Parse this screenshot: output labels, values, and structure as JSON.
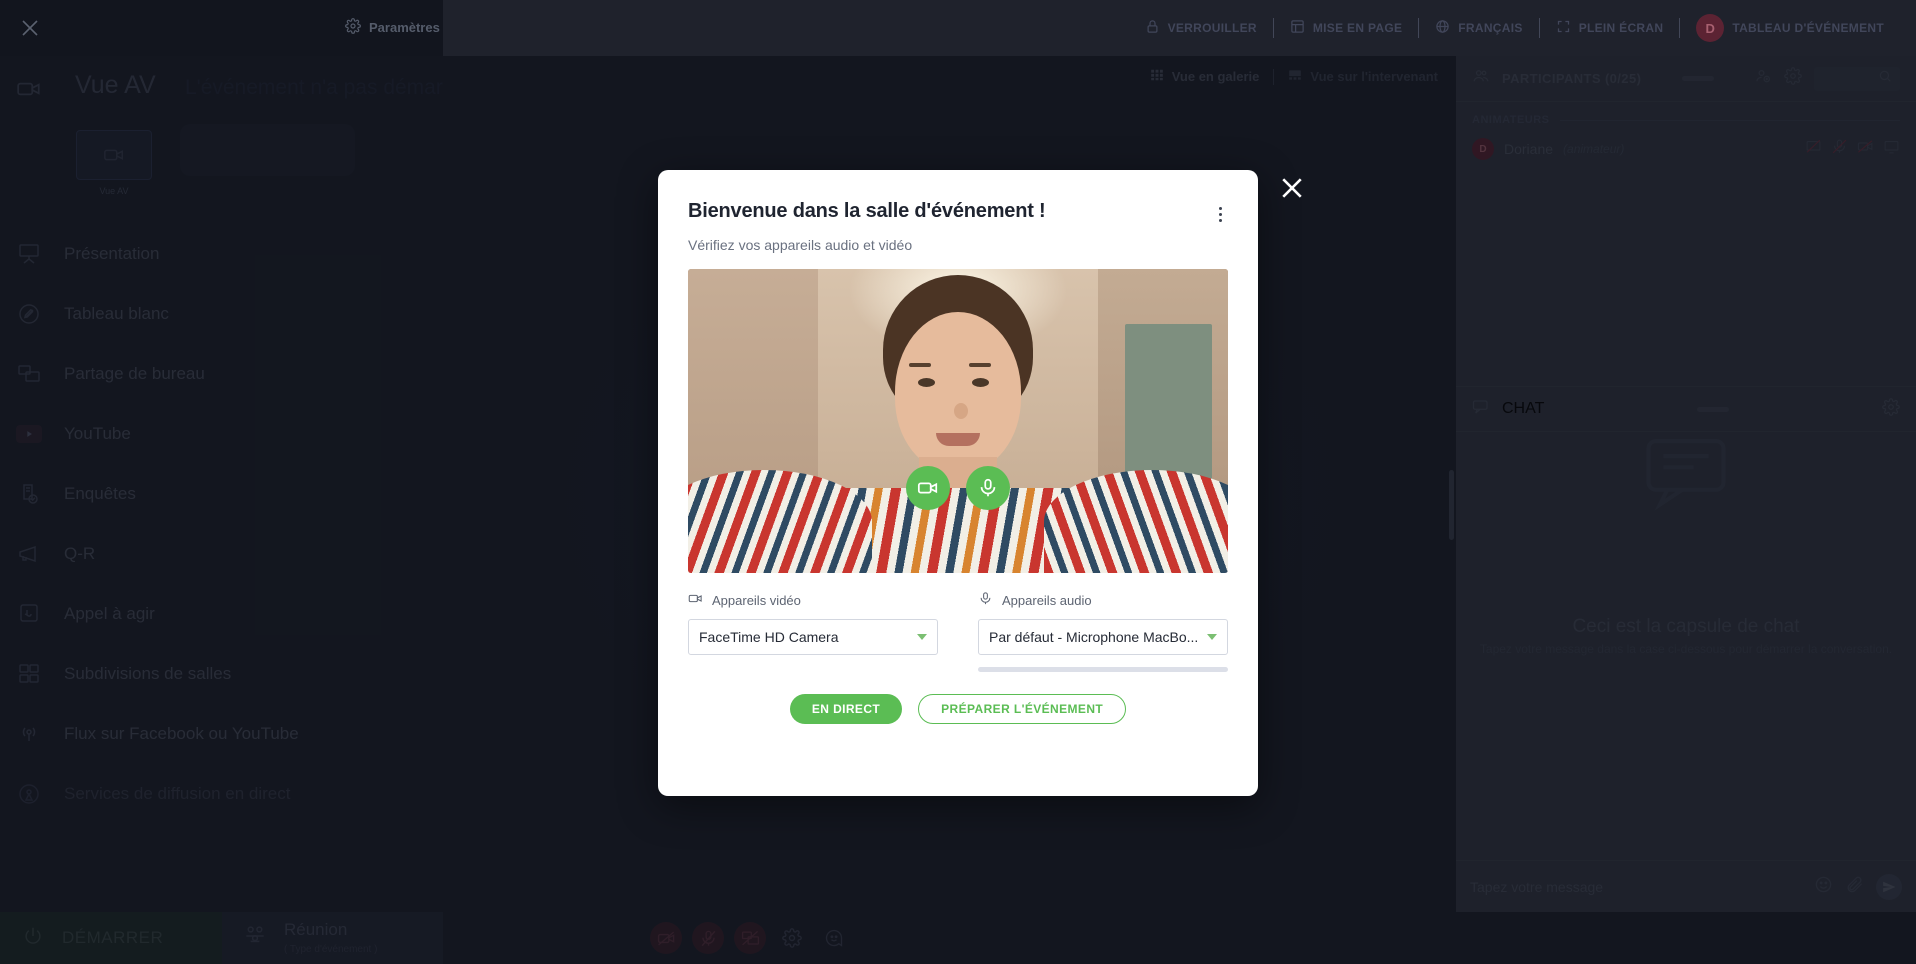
{
  "topbar": {
    "close_icon": "close-icon",
    "settings_label": "Paramètres",
    "items": [
      {
        "label": "VERROUILLER",
        "icon": "lock-icon"
      },
      {
        "label": "MISE EN PAGE",
        "icon": "layout-icon"
      },
      {
        "label": "FRANÇAIS",
        "icon": "globe-icon"
      },
      {
        "label": "PLEIN ÉCRAN",
        "icon": "fullscreen-icon"
      },
      {
        "label": "TABLEAU D'ÉVÉNEMENT",
        "icon": "dashboard-icon",
        "avatar": "D"
      }
    ]
  },
  "sidebar": {
    "header_title": "Vue AV",
    "header_ghost": "L'événement n'a pas démarré",
    "thumb_label": "Vue AV",
    "items": [
      {
        "label": "Présentation",
        "icon": "presentation-icon"
      },
      {
        "label": "Tableau blanc",
        "icon": "pencil-circle-icon"
      },
      {
        "label": "Partage de bureau",
        "icon": "screen-share-icon"
      },
      {
        "label": "YouTube",
        "icon": "youtube-icon"
      },
      {
        "label": "Enquêtes",
        "icon": "survey-icon"
      },
      {
        "label": "Q-R",
        "icon": "megaphone-icon"
      },
      {
        "label": "Appel à agir",
        "icon": "call-to-action-icon"
      },
      {
        "label": "Subdivisions de salles",
        "icon": "breakout-rooms-icon"
      },
      {
        "label": "Flux sur Facebook ou YouTube",
        "icon": "broadcast-icon"
      },
      {
        "label": "Services de diffusion en direct",
        "icon": "live-stream-icon"
      }
    ]
  },
  "stage": {
    "gallery_view_label": "Vue en galerie",
    "speaker_view_label": "Vue sur l'intervenant"
  },
  "bottombar": {
    "start_label": "DÉMARRER",
    "start_icon": "power-icon",
    "meeting_title": "Réunion",
    "meeting_subtitle": "( Type d'événement )",
    "meeting_icon": "people-icon",
    "tools": [
      {
        "icon": "camera-off-icon",
        "state": "off"
      },
      {
        "icon": "mic-off-icon",
        "state": "off"
      },
      {
        "icon": "screen-share-off-icon",
        "state": "off"
      },
      {
        "icon": "gear-icon",
        "state": "plain"
      },
      {
        "icon": "smiley-icon",
        "state": "plain"
      }
    ]
  },
  "right_panel": {
    "participants_title": "PARTICIPANTS (0/25)",
    "participants_icon": "people-icon",
    "add_user_icon": "add-user-icon",
    "gear_icon": "gear-icon",
    "search_icon": "search-icon",
    "hosts_section": "ANIMATEURS",
    "person": {
      "avatar_letter": "D",
      "name": "Doriane",
      "role": "(animateur)"
    },
    "chat_title": "CHAT",
    "chat_icon": "chat-icon",
    "chat_gear_icon": "gear-icon",
    "chat_empty_title": "Ceci est la capsule de chat",
    "chat_empty_sub": "Tapez votre message dans la case ci-dessous pour démarrer la conversation.",
    "chat_input_placeholder": "Tapez votre message",
    "emoji_icon": "smiley-icon",
    "attach_icon": "paperclip-icon",
    "send_icon": "send-icon"
  },
  "modal": {
    "title": "Bienvenue dans la salle d'événement !",
    "subtitle": "Vérifiez vos appareils audio et vidéo",
    "kebab_icon": "more-vertical-icon",
    "close_icon": "close-icon",
    "preview_camera_icon": "camera-icon",
    "preview_mic_icon": "mic-icon",
    "video_label": "Appareils vidéo",
    "video_icon": "camera-icon",
    "video_selected": "FaceTime HD Camera",
    "audio_label": "Appareils audio",
    "audio_icon": "mic-icon",
    "audio_selected": "Par défaut - Microphone MacBo...",
    "live_button": "EN DIRECT",
    "prepare_button": "PRÉPARER L'ÉVÉNEMENT"
  },
  "colors": {
    "accent_green": "#5bbd54",
    "panel_bg": "#333845",
    "app_bg": "#1b202b"
  }
}
